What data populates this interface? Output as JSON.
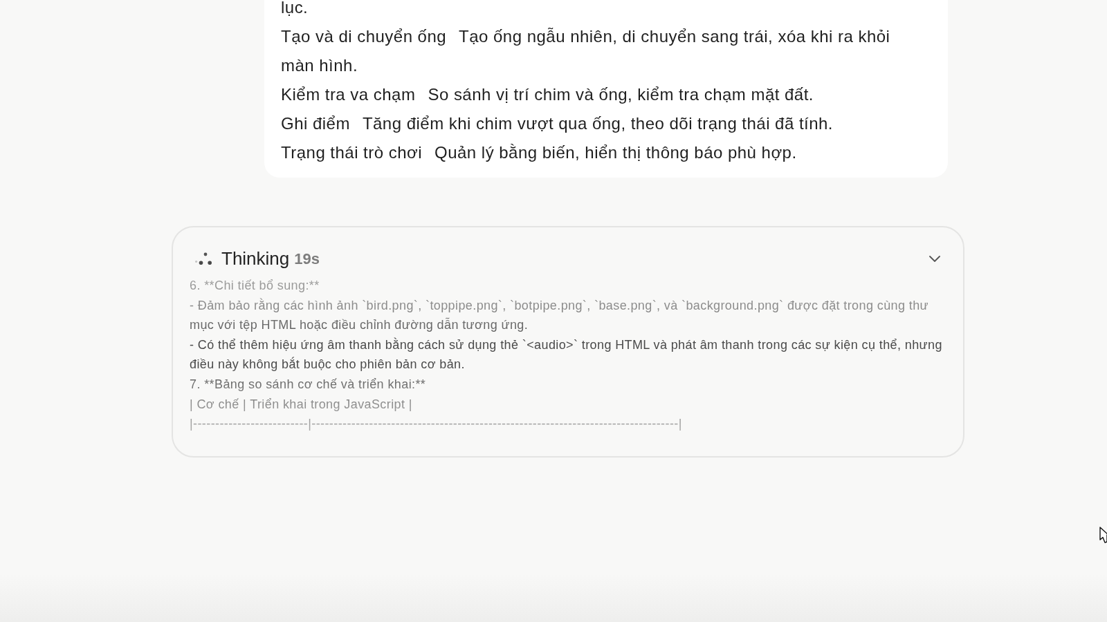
{
  "message": {
    "continued_text": "lục.",
    "rows": [
      {
        "mechanism": "Tạo và di chuyển ống",
        "implementation": "Tạo ống ngẫu nhiên, di chuyển sang trái, xóa khi ra khỏi màn hình."
      },
      {
        "mechanism": "Kiểm tra va chạm",
        "implementation": "So sánh vị trí chim và ống, kiểm tra chạm mặt đất."
      },
      {
        "mechanism": "Ghi điểm",
        "implementation": "Tăng điểm khi chim vượt qua ống, theo dõi trạng thái đã tính."
      },
      {
        "mechanism": "Trạng thái trò chơi",
        "implementation": "Quản lý bằng biến, hiển thị thông báo phù hợp."
      }
    ]
  },
  "thinking": {
    "title": "Thinking",
    "duration": "19s",
    "lines": [
      "6. **Chi tiết bổ sung:**",
      "- Đảm bảo rằng các hình ảnh `bird.png`, `toppipe.png`, `botpipe.png`, `base.png`, và `background.png` được đặt trong cùng thư mục với tệp HTML hoặc điều chỉnh đường dẫn tương ứng.",
      "- Có thể thêm hiệu ứng âm thanh bằng cách sử dụng thẻ `<audio>` trong HTML và phát âm thanh trong các sự kiện cụ thể, nhưng điều này không bắt buộc cho phiên bản cơ bản.",
      "7. **Bảng so sánh cơ chế và triển khai:**",
      "| Cơ chế | Triển khai trong JavaScript |",
      "|--------------------------|-----------------------------------------------------------------------------------|"
    ]
  }
}
